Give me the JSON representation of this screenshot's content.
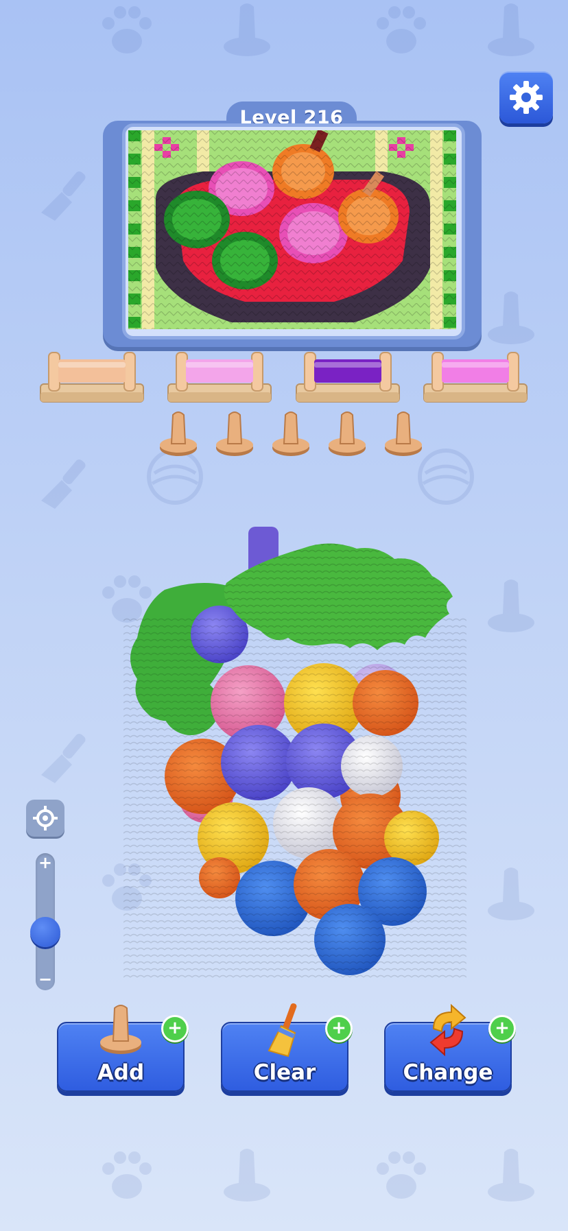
{
  "level": {
    "label": "Level 216"
  },
  "spools": [
    {
      "color_name": "peach",
      "color": "#f3c09a"
    },
    {
      "color_name": "light-pink",
      "color": "#f3a5ea"
    },
    {
      "color_name": "purple",
      "color": "#7a22c4"
    },
    {
      "color_name": "magenta",
      "color": "#f17ee6"
    }
  ],
  "pegs": {
    "count": 5,
    "color": "#e9b07e"
  },
  "zoom": {
    "plus": "+",
    "minus": "−",
    "level": 0.35
  },
  "actions": [
    {
      "id": "add",
      "label": "Add",
      "badge": "+",
      "icon": "peg-icon"
    },
    {
      "id": "clear",
      "label": "Clear",
      "badge": "+",
      "icon": "broom-icon"
    },
    {
      "id": "change",
      "label": "Change",
      "badge": "+",
      "icon": "swap-arrows-icon"
    }
  ],
  "colors": {
    "button_blue": "#2f5de0",
    "badge_green": "#4fcf4b",
    "frame_blue": "#6c8cd4"
  }
}
